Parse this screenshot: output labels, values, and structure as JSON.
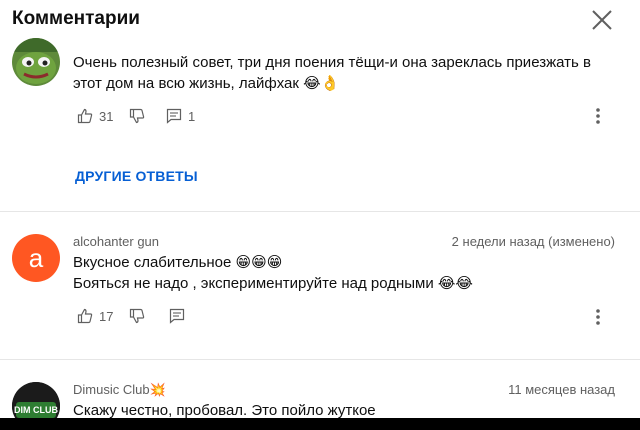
{
  "header": {
    "title": "Комментарии",
    "close_icon": "close-icon"
  },
  "comments": [
    {
      "author": "",
      "timestamp": "",
      "avatar_icon": "pepe-frog-avatar",
      "lines": [
        "Очень полезный совет, три дня поения тёщи-и она зареклась приезжать в",
        "этот дом на всю жизнь, лайфхак 😂👌"
      ],
      "likes": "31",
      "replies": "1"
    },
    {
      "author": "alcohanter gun",
      "timestamp": "2 недели назад (изменено)",
      "avatar_letter": "a",
      "avatar_color": "#ff5722",
      "lines": [
        "Вкусное слабительное 😁😁😁",
        "Бояться не надо , экспериментируйте над родными 😂😂"
      ],
      "likes": "17"
    },
    {
      "author": "Dimusic Club💥",
      "timestamp": "11 месяцев назад",
      "avatar_label": "DIM CLUB",
      "lines": [
        "Скажу честно, пробовал. Это пойло жуткое"
      ]
    }
  ],
  "other_replies_label": "ДРУГИЕ ОТВЕТЫ",
  "colors": {
    "link": "#065fd4",
    "secondary_text": "#606060",
    "divider": "#e6e6e6"
  }
}
